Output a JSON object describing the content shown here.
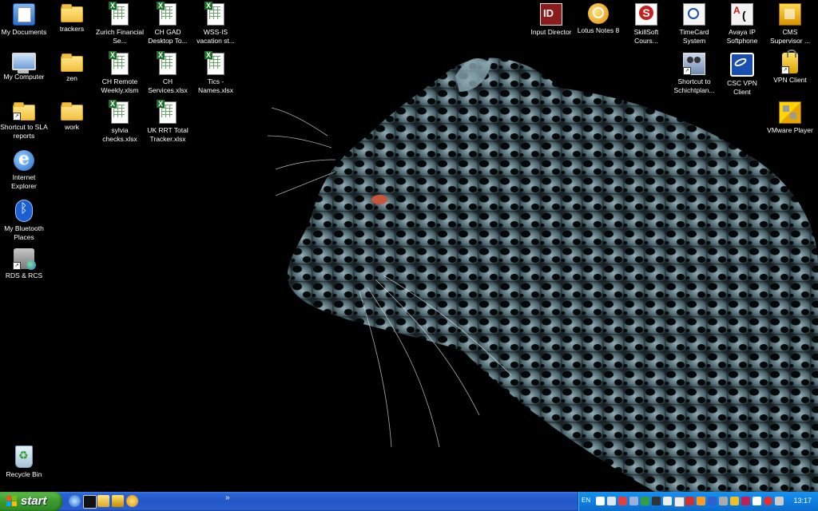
{
  "desktop": {
    "left_icons": [
      {
        "label": "My Documents",
        "icon": "my-documents-icon"
      },
      {
        "label": "My Computer",
        "icon": "my-computer-icon"
      },
      {
        "label": "Shortcut to SLA reports",
        "icon": "folder-icon"
      },
      {
        "label": "Internet Explorer",
        "icon": "internet-explorer-icon"
      },
      {
        "label": "My Bluetooth Places",
        "icon": "bluetooth-icon"
      },
      {
        "label": "RDS & RCS",
        "icon": "network-globe-icon"
      }
    ],
    "col2_icons": [
      {
        "label": "trackers",
        "icon": "folder-icon"
      },
      {
        "label": "zen",
        "icon": "folder-icon"
      },
      {
        "label": "work",
        "icon": "folder-icon"
      }
    ],
    "col3_icons": [
      {
        "label": "Zurich Financial Se...",
        "icon": "excel-file-icon"
      },
      {
        "label": "CH Remote Weekly.xlsm",
        "icon": "excel-file-icon"
      },
      {
        "label": "sylvia checks.xlsx",
        "icon": "excel-file-icon"
      }
    ],
    "col4_icons": [
      {
        "label": "CH GAD Desktop To...",
        "icon": "excel-file-icon"
      },
      {
        "label": "CH Services.xlsx",
        "icon": "excel-file-icon"
      },
      {
        "label": "UK RRT Total Tracker.xlsx",
        "icon": "excel-file-icon"
      }
    ],
    "col5_icons": [
      {
        "label": "WSS-IS vacation st...",
        "icon": "excel-file-icon"
      },
      {
        "label": "Tics - Names.xlsx",
        "icon": "excel-file-icon"
      }
    ],
    "right_icons_row1": [
      {
        "label": "Input Director",
        "icon": "input-director-icon"
      },
      {
        "label": "Lotus Notes 8",
        "icon": "lotus-notes-icon"
      },
      {
        "label": "SkillSoft Cours...",
        "icon": "skillsoft-icon"
      },
      {
        "label": "TimeCard System",
        "icon": "timecard-icon"
      },
      {
        "label": "Avaya IP Softphone",
        "icon": "avaya-softphone-icon"
      },
      {
        "label": "CMS Supervisor ...",
        "icon": "cms-supervisor-icon"
      }
    ],
    "right_icons_row2": [
      {
        "label": "Shortcut to Schichtplan...",
        "icon": "schichtplan-icon"
      },
      {
        "label": "CSC VPN Client",
        "icon": "csc-vpn-icon"
      },
      {
        "label": "VPN Client",
        "icon": "vpn-lock-icon"
      }
    ],
    "right_icons_row3": [
      {
        "label": "VMware Player",
        "icon": "vmware-icon"
      }
    ],
    "recycle_bin": {
      "label": "Recycle Bin",
      "icon": "recycle-bin-icon"
    }
  },
  "taskbar": {
    "start_label": "start",
    "language": "EN",
    "clock": "13:17",
    "quick_launch_chevron": "»",
    "quick_launch": [
      "ie-icon",
      "cmd-icon",
      "explorer-icon",
      "app-icon",
      "lotus-icon"
    ]
  }
}
